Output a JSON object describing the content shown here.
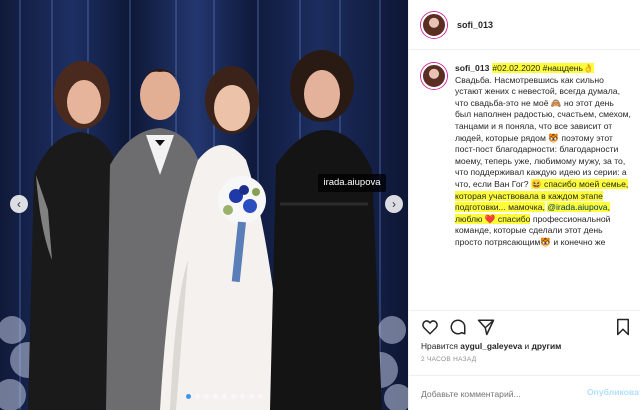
{
  "post": {
    "username": "sofi_013",
    "watermark": "irada.aiupova",
    "caption": {
      "author": "sofi_013",
      "hashtag_line": "#02.02.2020 #нащдень👌",
      "para1": "Свадьба. Насмотревшись как сильно устают жених с невестой, всегда думала, что свадьба-это не моё 🙈 но этот день был наполнен радостью, счастьем, смехом, танцами и я поняла, что все зависит от людей, которые рядом 🐯 поэтому этот пост-пост благодарности: благодарности моему, теперь уже, любимому мужу, за то, что поддерживал каждую идею из серии: а что, если Ван Гог?",
      "hl1": "😆 спасибо моей семье, которая участвовала в каждом этапе подготовки... мамочка,",
      "mention": "@irada.aiupova",
      "hl2": ", люблю ❤️ спасибо",
      "para2": "профессиональной команде, которые сделали этот день просто потрясающим🐯 и конечно же"
    },
    "likes_prefix": "Нравится",
    "likes_user": "aygul_galeyeva",
    "likes_and": "и",
    "likes_others": "другим",
    "time": "2 ЧАСОВ НАЗАД",
    "comment_placeholder": "Добавьте комментарий...",
    "post_label": "Опубликовать"
  },
  "carousel": {
    "slides": 9,
    "active_index": 0
  },
  "colors": {
    "accent": "#3897f0",
    "highlight": "#fdfd3a",
    "post_button": "#b2dffc"
  },
  "icons": [
    "heart-icon",
    "comment-icon",
    "share-icon",
    "bookmark-icon",
    "chevron-left-icon",
    "chevron-right-icon"
  ]
}
